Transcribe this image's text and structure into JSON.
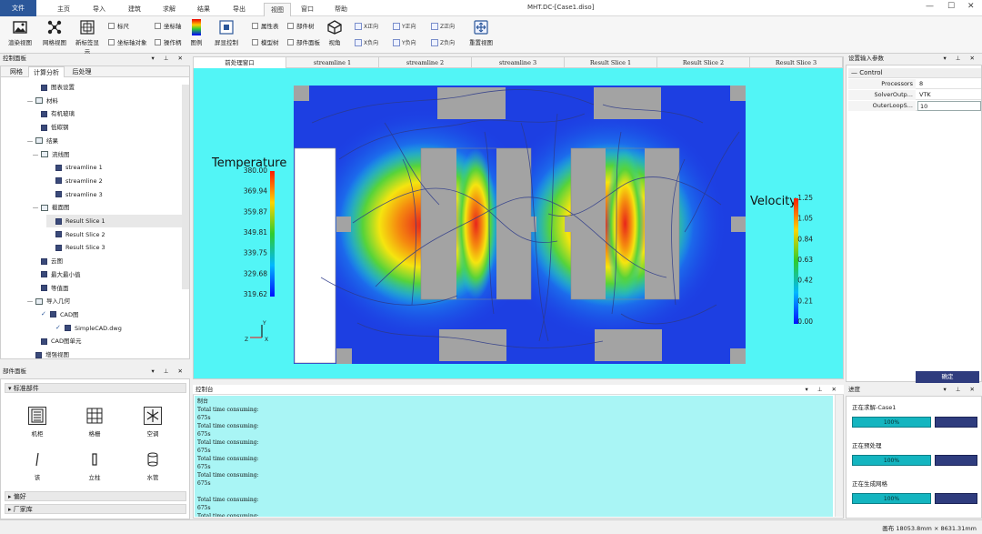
{
  "window": {
    "title": "MHT.DC-[Case1.diso]",
    "minimize": "—",
    "maximize": "☐",
    "close": "✕"
  },
  "menu_tabs": [
    "文件",
    "主页",
    "导入",
    "建筑",
    "求解",
    "结果",
    "导出",
    "视图",
    "窗口",
    "帮助"
  ],
  "ribbon": {
    "buttons": [
      "渲染视图",
      "网格视图",
      "新标签显示",
      "图例",
      "屏显控制",
      "视角",
      "重置视图"
    ],
    "checks": [
      "标尺",
      "坐标轴",
      "坐标轴对象",
      "操作柄",
      "属性表",
      "部件树",
      "模型树",
      "部件面板"
    ],
    "axis": [
      "X正向",
      "Y正向",
      "Z正向",
      "X负向",
      "Y负向",
      "Z负向"
    ]
  },
  "control_panel": {
    "title": "控制面板",
    "tabs": [
      "网格",
      "计算分析",
      "后处理"
    ],
    "tree": [
      {
        "label": "图表设置",
        "lvl": 2,
        "t": "i"
      },
      {
        "label": "材料",
        "lvl": 1,
        "t": "f"
      },
      {
        "label": "有机玻璃",
        "lvl": 2,
        "t": "i"
      },
      {
        "label": "低碳钢",
        "lvl": 2,
        "t": "i"
      },
      {
        "label": "结果",
        "lvl": 1,
        "t": "f"
      },
      {
        "label": "流线图",
        "lvl": 2,
        "t": "f"
      },
      {
        "label": "streamline 1",
        "lvl": 3,
        "t": "i"
      },
      {
        "label": "streamline 2",
        "lvl": 3,
        "t": "i"
      },
      {
        "label": "streamline 3",
        "lvl": 3,
        "t": "i"
      },
      {
        "label": "截面图",
        "lvl": 2,
        "t": "f"
      },
      {
        "label": "Result Slice 1",
        "lvl": 3,
        "t": "i"
      },
      {
        "label": "Result Slice 2",
        "lvl": 3,
        "t": "i"
      },
      {
        "label": "Result Slice 3",
        "lvl": 3,
        "t": "i"
      },
      {
        "label": "云图",
        "lvl": 2,
        "t": "i"
      },
      {
        "label": "最大最小值",
        "lvl": 2,
        "t": "i"
      },
      {
        "label": "等值面",
        "lvl": 2,
        "t": "i"
      },
      {
        "label": "导入几何",
        "lvl": 1,
        "t": "f"
      },
      {
        "label": "CAD图",
        "lvl": 2,
        "t": "i"
      },
      {
        "label": "SimpleCAD.dwg",
        "lvl": 3,
        "t": "i"
      },
      {
        "label": "CAD图单元",
        "lvl": 2,
        "t": "i"
      },
      {
        "label": "增强视图",
        "lvl": 1,
        "t": "i"
      }
    ]
  },
  "component_panel": {
    "title": "部件面板",
    "section": "标准部件",
    "items": [
      "机柜",
      "格栅",
      "空调",
      "该",
      "立柱",
      "水管"
    ],
    "sections": [
      "偏好",
      "厂家库"
    ]
  },
  "doc_tabs": [
    "前处理窗口",
    "streamline 1",
    "streamline 2",
    "streamline 3",
    "Result Slice 1",
    "Result Slice 2",
    "Result Slice 3"
  ],
  "legend_temp": {
    "title": "Temperature",
    "ticks": [
      "380.00",
      "369.94",
      "359.87",
      "349.81",
      "339.75",
      "329.68",
      "319.62"
    ]
  },
  "legend_vel": {
    "title": "Velocity",
    "ticks": [
      "1.25",
      "1.05",
      "0.84",
      "0.63",
      "0.42",
      "0.21",
      "0.00"
    ]
  },
  "triad": {
    "x": "X",
    "y": "Y",
    "z": "Z"
  },
  "console": {
    "title": "控制台",
    "text": "制台\nTotal time consuming:\n675s\nTotal time consuming:\n675s\nTotal time consuming:\n675s\nTotal time consuming:\n675s\nTotal time consuming:\n675s\n\nTotal time consuming:\n675s\nTotal time consuming:\n675s"
  },
  "settings": {
    "title": "设置输入参数",
    "group": "Control",
    "rows": [
      [
        "Processors",
        "8"
      ],
      [
        "SolverOutp...",
        "VTK"
      ],
      [
        "OuterLoopS...",
        "10"
      ]
    ],
    "ok": "确定"
  },
  "progress": {
    "title": "进度",
    "items": [
      [
        "正在求解-Case1",
        "100%"
      ],
      [
        "正在预处理",
        "100%"
      ],
      [
        "正在生成网格",
        "100%"
      ]
    ]
  },
  "status": {
    "coords": "画布 18053.8mm × 8631.31mm"
  }
}
